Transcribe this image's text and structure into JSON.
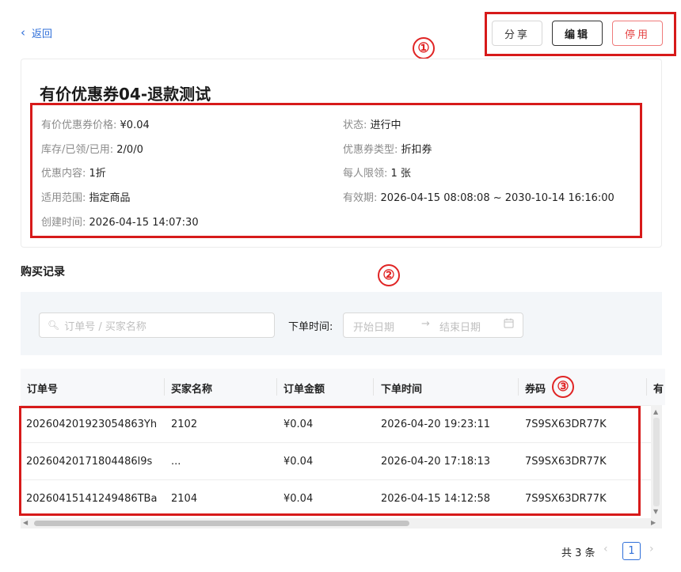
{
  "nav": {
    "back_label": "返回",
    "back_icon": "chevron-left-icon"
  },
  "actions": {
    "share": "分享",
    "edit": "编辑",
    "disable": "停用"
  },
  "markers": [
    "①",
    "②",
    "③"
  ],
  "coupon": {
    "title": "有价优惠券04-退款测试",
    "fields": [
      {
        "label": "有价优惠券价格:",
        "value": "¥0.04"
      },
      {
        "label": "状态:",
        "value": "进行中"
      },
      {
        "label": "库存/已领/已用:",
        "value": "2/0/0"
      },
      {
        "label": "优惠券类型:",
        "value": "折扣券"
      },
      {
        "label": "优惠内容:",
        "value": "1折"
      },
      {
        "label": "每人限领:",
        "value": "1 张"
      },
      {
        "label": "适用范围:",
        "value": "指定商品"
      },
      {
        "label": "有效期:",
        "value": "2026-04-15 08:08:08 ~ 2030-10-14 16:16:00"
      },
      {
        "label": "创建时间:",
        "value": "2026-04-15 14:07:30"
      }
    ]
  },
  "records": {
    "title": "购买记录",
    "search_placeholder": "订单号 / 买家名称",
    "time_label": "下单时间:",
    "start_placeholder": "开始日期",
    "end_placeholder": "结束日期",
    "columns": [
      "订单号",
      "买家名称",
      "订单金额",
      "下单时间",
      "券码",
      "有"
    ],
    "rows": [
      [
        "202604201923054863Yh",
        "2102",
        "¥0.04",
        "2026-04-20 19:23:11",
        "7S9SX63DR77K"
      ],
      [
        "20260420171804486l9s",
        "...",
        "¥0.04",
        "2026-04-20 17:18:13",
        "7S9SX63DR77K"
      ],
      [
        "20260415141249486TBa",
        "2104",
        "¥0.04",
        "2026-04-15 14:12:58",
        "7S9SX63DR77K"
      ]
    ]
  },
  "pagination": {
    "total": "共 3 条",
    "current": "1"
  },
  "colors": {
    "accent": "#2f6fd9",
    "danger": "#e54545",
    "annotation": "#d71a1a"
  }
}
